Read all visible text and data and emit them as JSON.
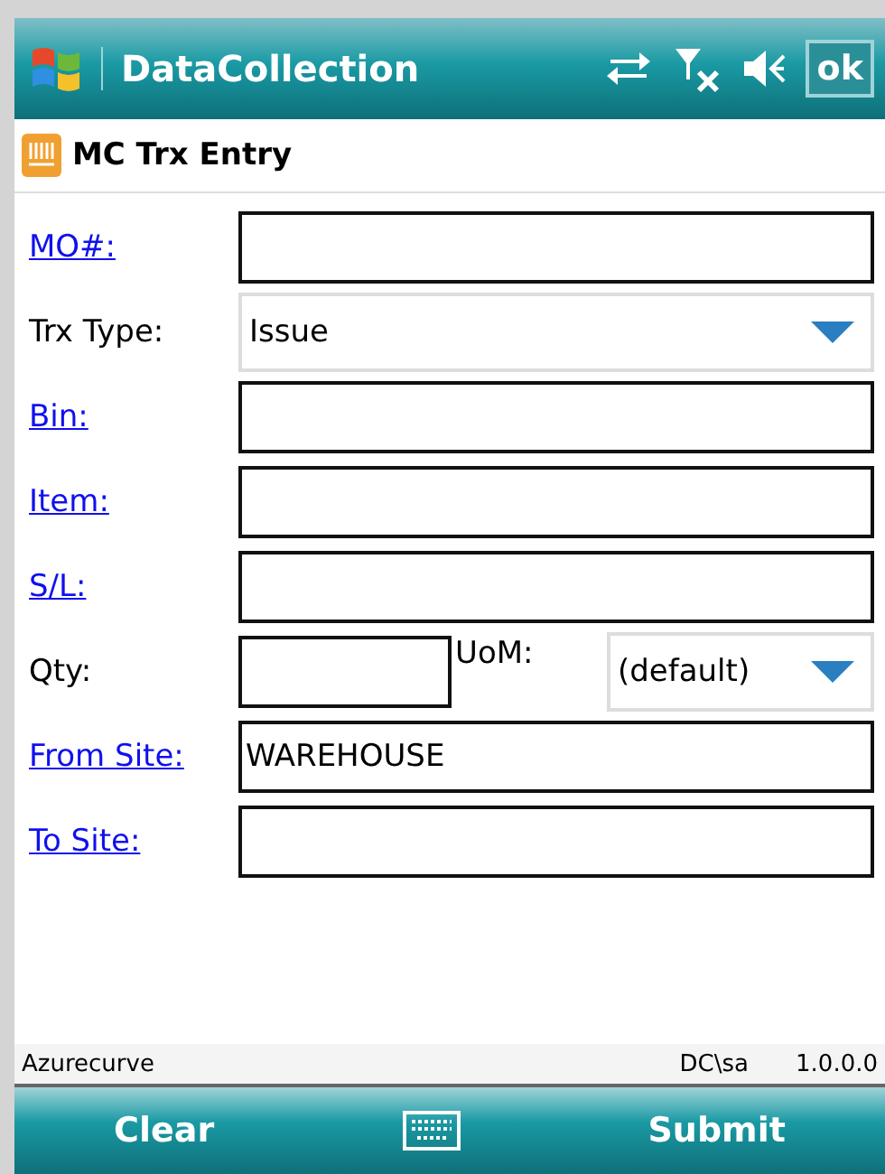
{
  "title_bar": {
    "title": "DataCollection",
    "ok_button": "ok"
  },
  "form_title": "MC Trx Entry",
  "fields": [
    {
      "kind": "text",
      "label": "MO#:",
      "link": true
    },
    {
      "kind": "select",
      "label": "Trx Type:",
      "link": false,
      "value": "Issue"
    },
    {
      "kind": "text",
      "label": "Bin:",
      "link": true
    },
    {
      "kind": "text",
      "label": "Item:",
      "link": true
    },
    {
      "kind": "text",
      "label": "S/L:",
      "link": true
    },
    {
      "kind": "qty",
      "label": "Qty:",
      "link": false,
      "unit_label": "UoM:",
      "unit_value": "(default)"
    },
    {
      "kind": "text",
      "label": "From Site:",
      "link": true,
      "value": "WAREHOUSE"
    },
    {
      "kind": "text",
      "label": "To Site:",
      "link": true
    }
  ],
  "status_bar": {
    "company": "Azurecurve",
    "user": "DC\\sa",
    "version": "1.0.0.0"
  },
  "menu_bar": {
    "left": "Clear",
    "right": "Submit"
  }
}
